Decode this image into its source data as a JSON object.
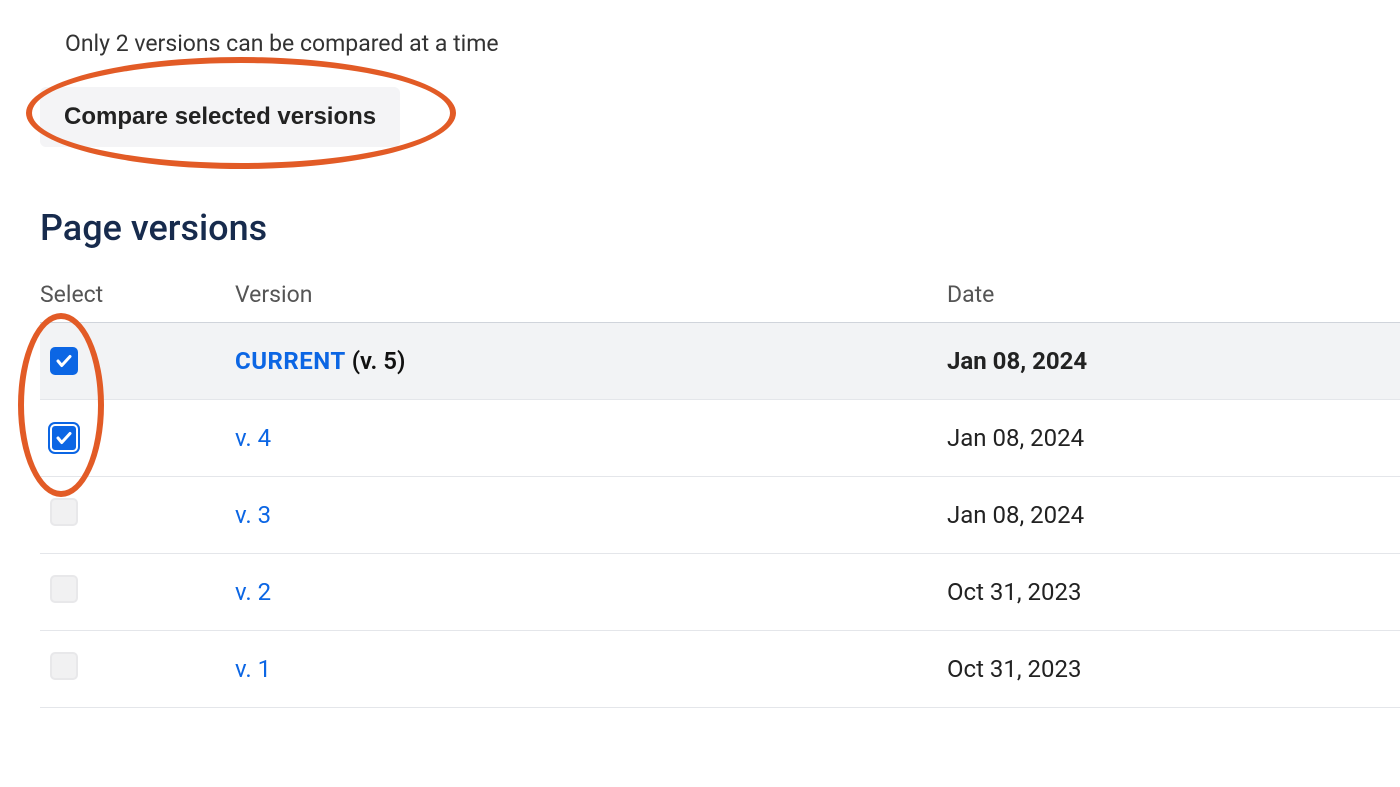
{
  "info_text": "Only 2 versions can be compared at a time",
  "compare_button_label": "Compare selected versions",
  "heading": "Page versions",
  "table": {
    "headers": {
      "select": "Select",
      "version": "Version",
      "date": "Date"
    },
    "rows": [
      {
        "checked": true,
        "focus_ring": false,
        "highlight": true,
        "version_link": "CURRENT",
        "version_suffix": " (v. 5)",
        "date": "Jan 08, 2024"
      },
      {
        "checked": true,
        "focus_ring": true,
        "highlight": false,
        "version_link": "v. 4",
        "version_suffix": "",
        "date": "Jan 08, 2024"
      },
      {
        "checked": false,
        "focus_ring": false,
        "highlight": false,
        "version_link": "v. 3",
        "version_suffix": "",
        "date": "Jan 08, 2024"
      },
      {
        "checked": false,
        "focus_ring": false,
        "highlight": false,
        "version_link": "v. 2",
        "version_suffix": "",
        "date": "Oct 31, 2023"
      },
      {
        "checked": false,
        "focus_ring": false,
        "highlight": false,
        "version_link": "v. 1",
        "version_suffix": "",
        "date": "Oct 31, 2023"
      }
    ]
  },
  "annotation_color": "#e25b26"
}
